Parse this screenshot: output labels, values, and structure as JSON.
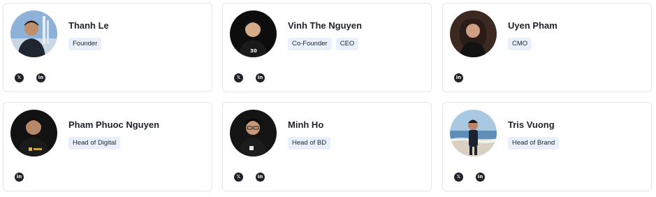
{
  "team": [
    {
      "name": "Thanh Le",
      "roles": [
        "Founder"
      ],
      "socials": [
        "x-icon",
        "linkedin-icon"
      ],
      "avatar_bg": "#7fa6cf"
    },
    {
      "name": "Vinh The Nguyen",
      "roles": [
        "Co-Founder",
        "CEO"
      ],
      "socials": [
        "x-icon",
        "linkedin-icon"
      ],
      "avatar_bg": "#111111"
    },
    {
      "name": "Uyen Pham",
      "roles": [
        "CMO"
      ],
      "socials": [
        "linkedin-icon"
      ],
      "avatar_bg": "#3a2a24"
    },
    {
      "name": "Pham Phuoc Nguyen",
      "roles": [
        "Head of Digital"
      ],
      "socials": [
        "linkedin-icon"
      ],
      "avatar_bg": "#141414"
    },
    {
      "name": "Minh Ho",
      "roles": [
        "Head of BD"
      ],
      "socials": [
        "x-icon",
        "linkedin-icon"
      ],
      "avatar_bg": "#151515"
    },
    {
      "name": "Tris Vuong",
      "roles": [
        "Head of Brand"
      ],
      "socials": [
        "x-icon",
        "linkedin-icon"
      ],
      "avatar_bg": "#8fb6d6"
    }
  ],
  "icons": {
    "x": "𝕏",
    "linkedin": "in"
  },
  "colors": {
    "tag_bg": "#e9f0fb",
    "border": "#e3e6ea",
    "text": "#1f2329"
  }
}
